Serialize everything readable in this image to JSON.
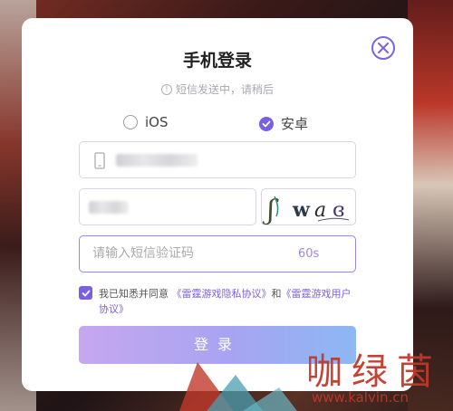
{
  "dialog": {
    "title": "手机登录",
    "notice": "短信发送中，请稍后",
    "notice_icon": "!"
  },
  "platform": {
    "options": [
      {
        "label": "iOS",
        "selected": false
      },
      {
        "label": "安卓",
        "selected": true
      }
    ]
  },
  "form": {
    "sms_placeholder": "请输入短信验证码",
    "sms_value": "",
    "countdown": "60s",
    "captcha_chars": [
      "ʃ",
      "w",
      "a",
      "ɞ"
    ]
  },
  "agreement": {
    "checked": true,
    "prefix": "我已知悉并同意",
    "privacy_link": "《雷霆游戏隐私协议》",
    "and": "和",
    "user_link": "《雷霆游戏用户协议》"
  },
  "login_button": "登录",
  "watermark": {
    "text": "咖绿茵",
    "url": "www.kalvin.cn"
  },
  "colors": {
    "accent": "#7b5ee6",
    "button_gradient": [
      "#c6a7f0",
      "#8db8f2"
    ],
    "watermark": "#c0392b"
  }
}
